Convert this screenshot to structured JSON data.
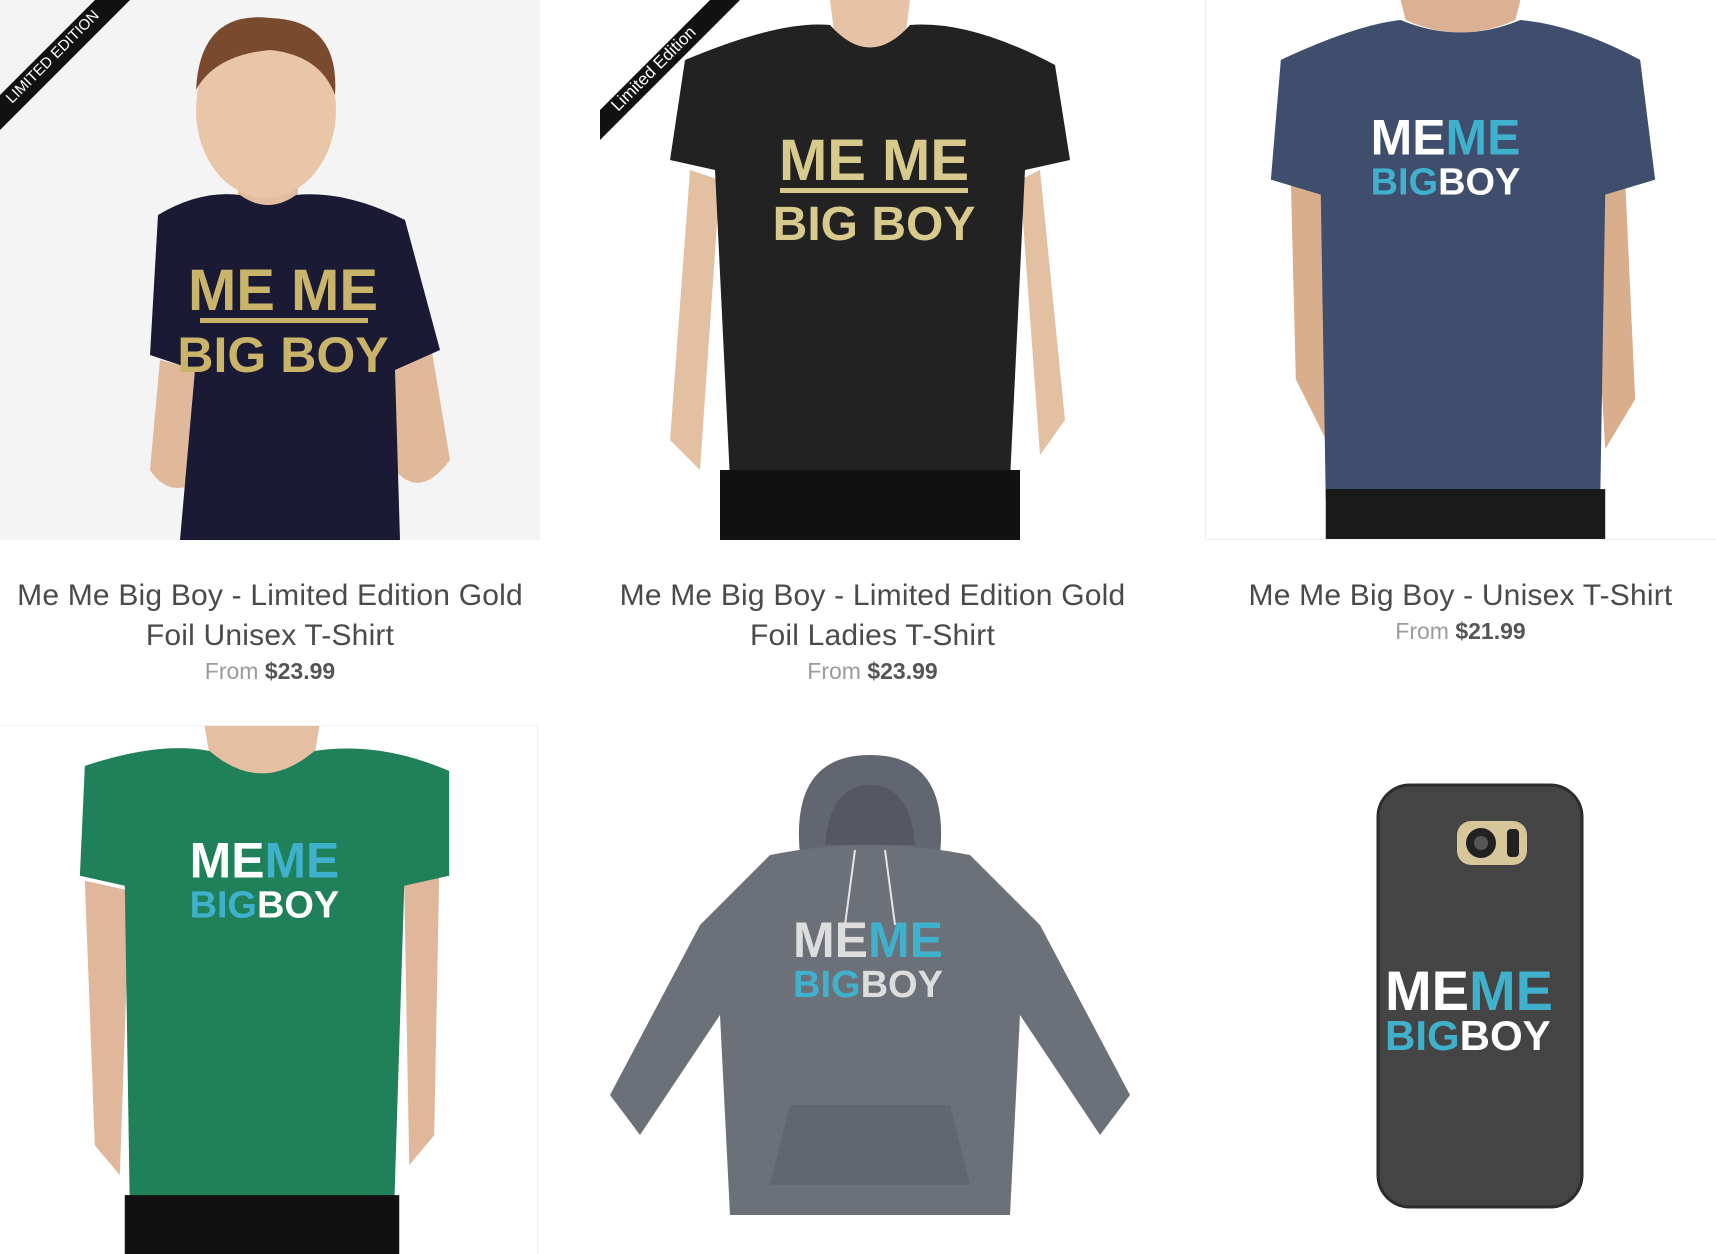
{
  "products": [
    {
      "title_line1": "Me Me Big Boy - Limited Edition Gold",
      "title_line2": "Foil Unisex T-Shirt",
      "from_label": "From",
      "price": "$23.99",
      "ribbon": "LIMITED EDITION",
      "print_line1": "ME ME",
      "print_line2": "BIG BOY"
    },
    {
      "title_line1": "Me Me Big Boy - Limited Edition Gold",
      "title_line2": "Foil Ladies T-Shirt",
      "from_label": "From",
      "price": "$23.99",
      "ribbon": "Limited Edition",
      "print_line1": "ME ME",
      "print_line2": "BIG BOY"
    },
    {
      "title_line1": "Me Me Big Boy - Unisex T-Shirt",
      "from_label": "From",
      "price": "$21.99",
      "print_a1": "ME",
      "print_b1": "ME",
      "print_a2": "BIG",
      "print_b2": "BOY"
    },
    {
      "print_a1": "ME",
      "print_b1": "ME",
      "print_a2": "BIG",
      "print_b2": "BOY"
    },
    {
      "print_a1": "ME",
      "print_b1": "ME",
      "print_a2": "BIG",
      "print_b2": "BOY"
    },
    {
      "print_a1": "ME",
      "print_b1": "ME",
      "print_a2": "BIG",
      "print_b2": "BOY"
    }
  ],
  "colors": {
    "gold": "#c9b46a",
    "teal": "#3fb1cc",
    "navy_shirt": "#1b1a35",
    "black_shirt": "#222222",
    "heather_navy": "#3e4e6c",
    "kelly_green": "#20805a",
    "heather_grey": "#6c7078",
    "phone_case": "#444444"
  }
}
